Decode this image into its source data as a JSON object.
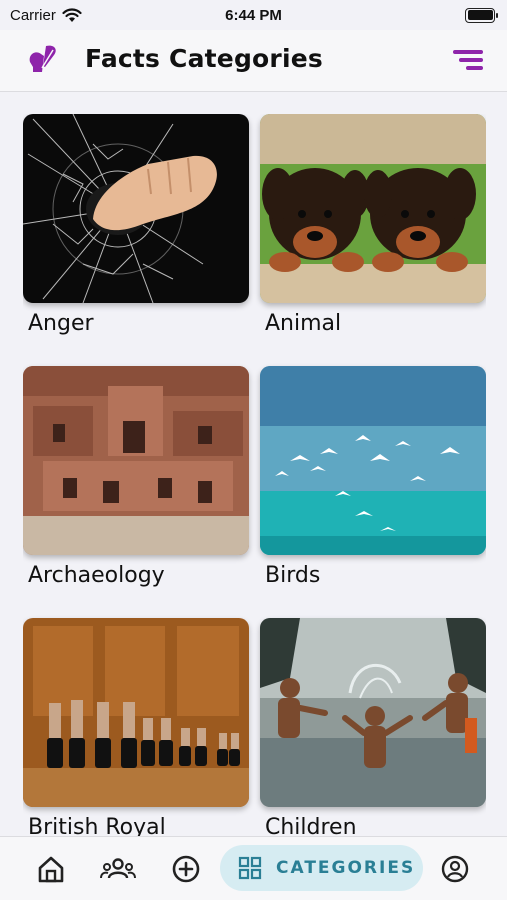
{
  "status": {
    "carrier": "Carrier",
    "time": "6:44 PM"
  },
  "header": {
    "title": "Facts Categories",
    "logo_icon": "brain-feather-icon",
    "menu_icon": "filter-menu-icon"
  },
  "categories": [
    {
      "label": "Anger",
      "image": "shattered-glass-fist"
    },
    {
      "label": "Animal",
      "image": "two-puppies"
    },
    {
      "label": "Archaeology",
      "image": "rock-tombs"
    },
    {
      "label": "Birds",
      "image": "seagulls-over-sea"
    },
    {
      "label": "British Royal",
      "image": "row-of-boots"
    },
    {
      "label": "Children",
      "image": "children-splashing-water"
    }
  ],
  "bottom_nav": {
    "items": [
      {
        "icon": "home-icon"
      },
      {
        "icon": "group-icon"
      },
      {
        "icon": "add-circle-icon"
      },
      {
        "icon": "grid-icon",
        "label": "CATEGORIES",
        "active": true
      },
      {
        "icon": "profile-icon"
      }
    ]
  },
  "colors": {
    "accent": "#8e24aa",
    "nav_active_bg": "#d6ecf2",
    "nav_active_text": "#2a7f95"
  }
}
